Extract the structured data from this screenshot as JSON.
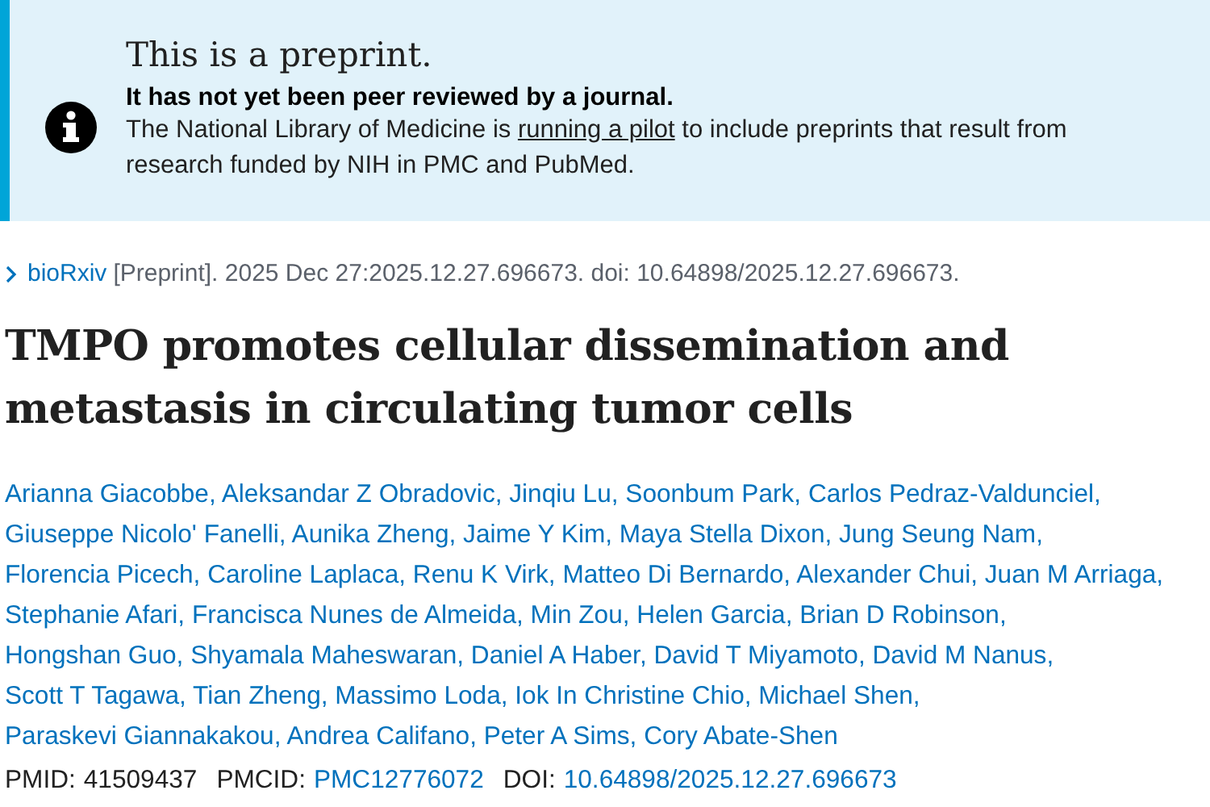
{
  "banner": {
    "title": "This is a preprint.",
    "subtitle": "It has not yet been peer reviewed by a journal.",
    "body_before": "The National Library of Medicine is",
    "body_link": "running a pilot",
    "body_after": "to include preprints that result from research funded by NIH in PMC and PubMed."
  },
  "citation": {
    "journal": "bioRxiv",
    "text": "[Preprint]. 2025 Dec 27:2025.12.27.696673. doi: 10.64898/2025.12.27.696673."
  },
  "title": "TMPO promotes cellular dissemination and metastasis in circulating tumor cells",
  "author_separator": ",",
  "author_lines": [
    [
      "Arianna Giacobbe",
      "Aleksandar Z Obradovic",
      "Jinqiu Lu",
      "Soonbum Park",
      "Carlos Pedraz-Valdunciel"
    ],
    [
      "Giuseppe Nicolo' Fanelli",
      "Aunika Zheng",
      "Jaime Y Kim",
      "Maya Stella Dixon",
      "Jung Seung Nam"
    ],
    [
      "Florencia Picech",
      "Caroline Laplaca",
      "Renu K Virk",
      "Matteo Di Bernardo",
      "Alexander Chui",
      "Juan M Arriaga"
    ],
    [
      "Stephanie Afari",
      "Francisca Nunes de Almeida",
      "Min Zou",
      "Helen Garcia",
      "Brian D Robinson"
    ],
    [
      "Hongshan Guo",
      "Shyamala Maheswaran",
      "Daniel A Haber",
      "David T Miyamoto",
      "David M Nanus"
    ],
    [
      "Scott T Tagawa",
      "Tian Zheng",
      "Massimo Loda",
      "Iok In Christine Chio",
      "Michael Shen"
    ],
    [
      "Paraskevi Giannakakou",
      "Andrea Califano",
      "Peter A Sims",
      "Cory Abate-Shen"
    ]
  ],
  "identifiers": [
    {
      "label": "PMID:",
      "value": "41509437",
      "link": false
    },
    {
      "label": "PMCID:",
      "value": "PMC12776072",
      "link": true
    },
    {
      "label": "DOI:",
      "value": "10.64898/2025.12.27.696673",
      "link": true
    }
  ]
}
